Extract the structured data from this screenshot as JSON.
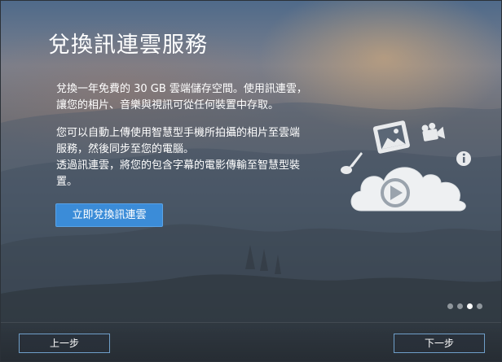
{
  "title": "兌換訊連雲服務",
  "paragraph1": [
    "兌換一年免費的 30 GB 雲端儲存空間。使用訊連雲，",
    "讓您的相片、音樂與視訊可從任何裝置中存取。"
  ],
  "paragraph2": [
    "您可以自動上傳使用智慧型手機所拍攝的相片至雲端",
    "服務，然後同步至您的電腦。",
    "透過訊連雲，將您的包含字幕的電影傳輸至智慧型裝",
    "置。"
  ],
  "cta_label": "立即兌換訊連雲",
  "pagination": {
    "total": 4,
    "active_index": 2
  },
  "footer": {
    "prev_label": "上一步",
    "next_label": "下一步"
  },
  "icons": [
    "music-note-icon",
    "picture-icon",
    "video-camera-icon",
    "info-icon",
    "cloud-play-icon"
  ],
  "colors": {
    "accent": "#3b8cd8",
    "nav_border": "#6f9fc9"
  }
}
